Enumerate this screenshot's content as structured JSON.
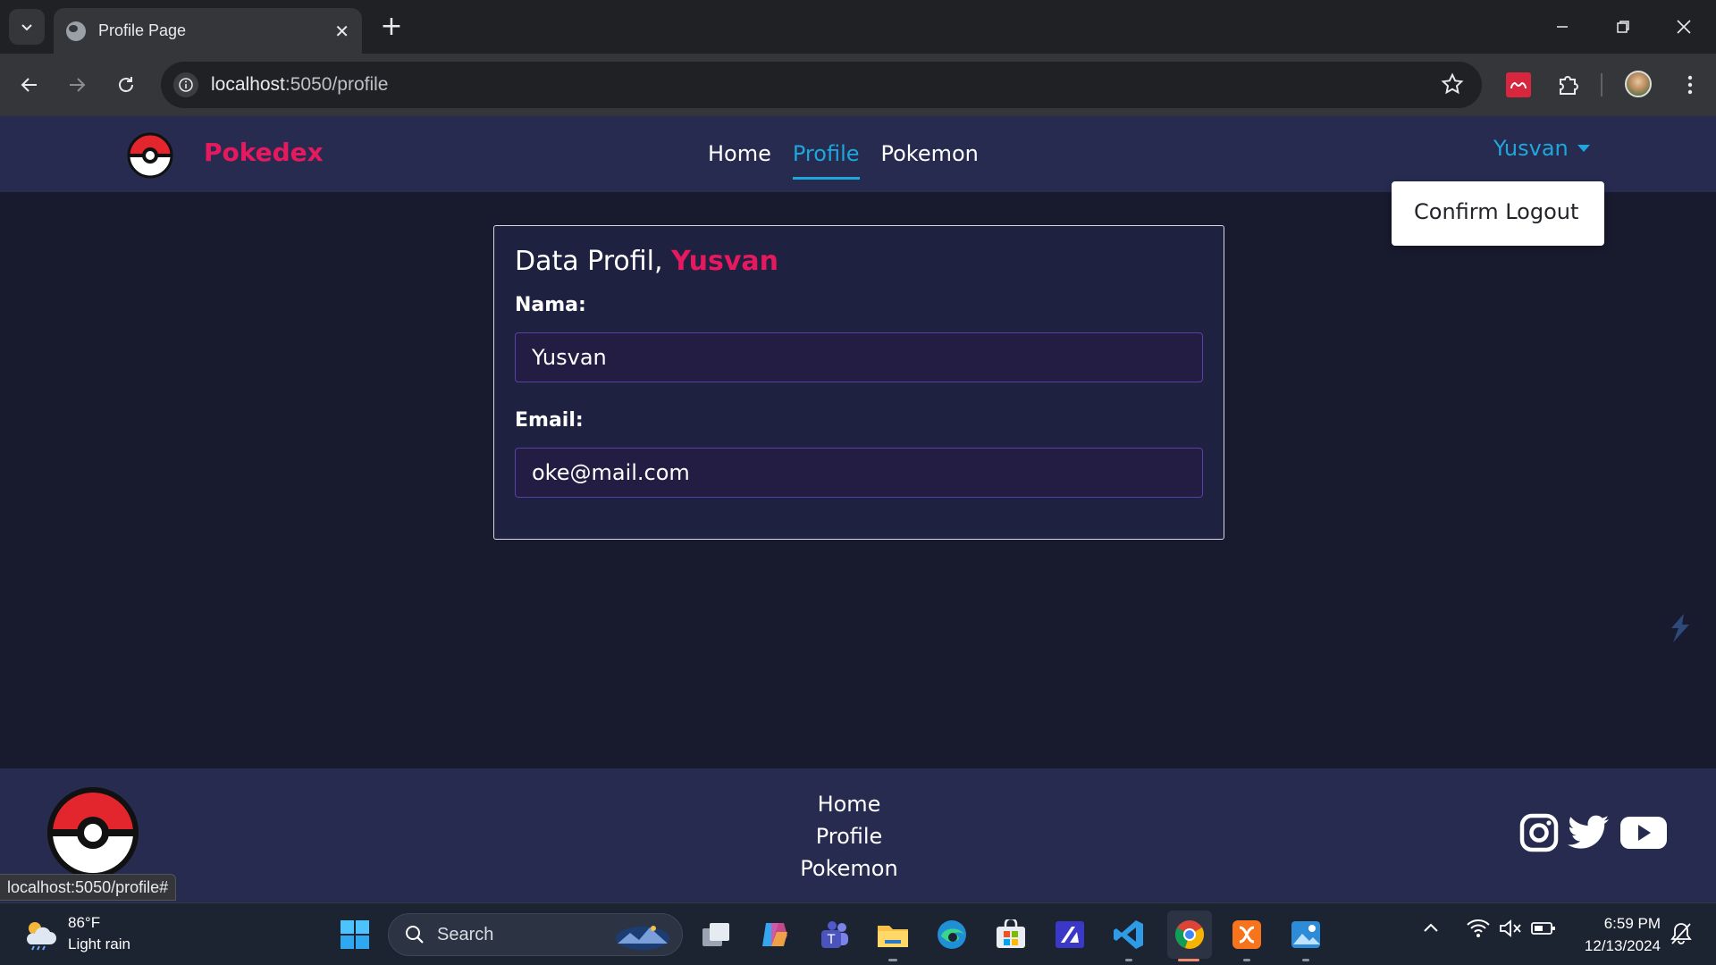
{
  "browser": {
    "tab_title": "Profile Page",
    "url_host": "localhost",
    "url_rest": ":5050/profile",
    "status_url": "localhost:5050/profile#"
  },
  "site": {
    "brand": "Pokedex",
    "nav": [
      "Home",
      "Profile",
      "Pokemon"
    ],
    "active_nav": "Profile",
    "user_menu_label": "Yusvan",
    "dropdown_item": "Confirm Logout"
  },
  "profile": {
    "title_prefix": "Data Profil, ",
    "title_name": "Yusvan",
    "name_label": "Nama:",
    "name_value": "Yusvan",
    "email_label": "Email:",
    "email_value": "oke@mail.com"
  },
  "footer": {
    "links": [
      "Home",
      "Profile",
      "Pokemon"
    ],
    "socials": [
      "instagram-icon",
      "twitter-icon",
      "youtube-icon"
    ]
  },
  "taskbar": {
    "temperature": "86°F",
    "weather": "Light rain",
    "search_placeholder": "Search",
    "time": "6:59 PM",
    "date": "12/13/2024"
  },
  "colors": {
    "brand_pink": "#e6195f",
    "active_blue": "#1ea7dc",
    "nav_bg": "#272b50",
    "page_bg": "#181a2e"
  }
}
